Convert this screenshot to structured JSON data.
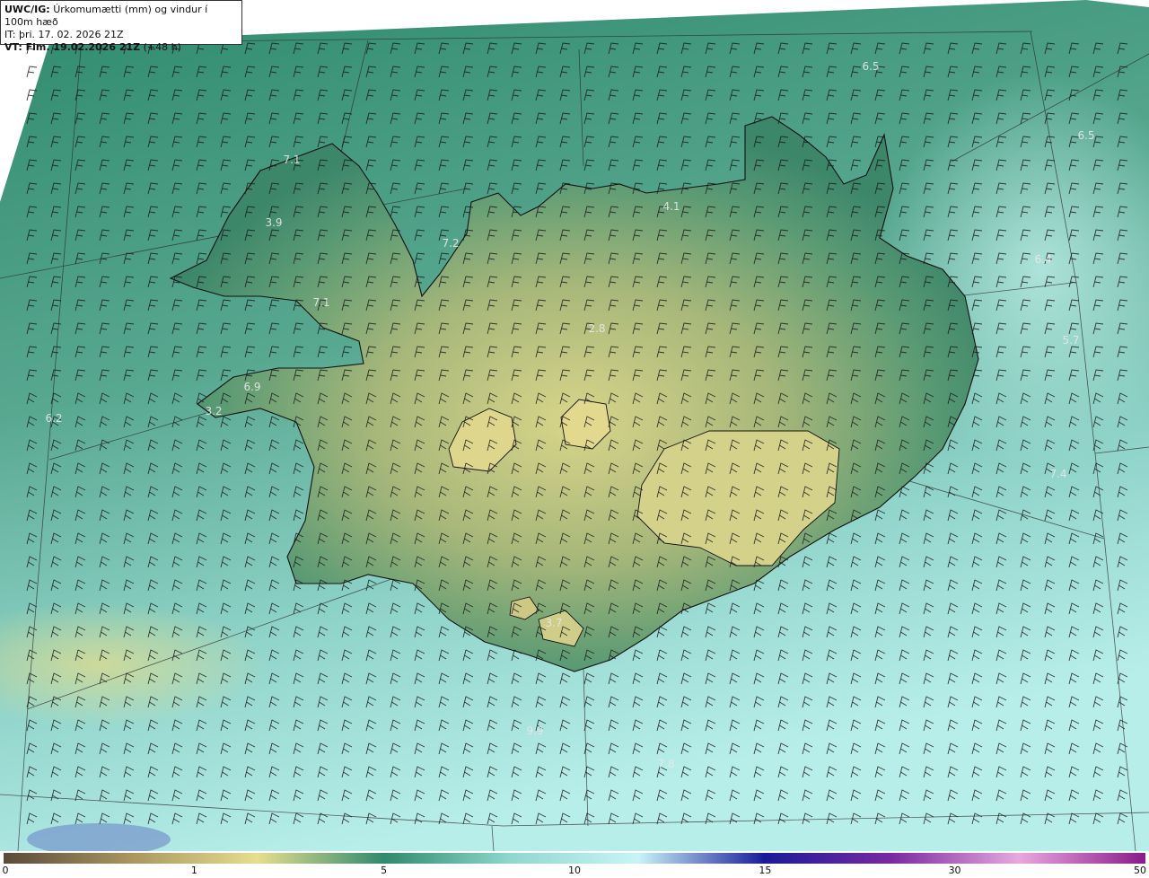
{
  "header": {
    "model_label": "UWC/IG:",
    "parameter": "Úrkomumætti (mm) og vindur í 100m hæð",
    "it_label": "IT:",
    "it_value": "þri. 17. 02. 2026 21Z",
    "vt_label": "VT: Fim. 19.02.2026 21Z",
    "vt_lead": "(+48 h)"
  },
  "colorbar": {
    "ticks": [
      {
        "label": "0",
        "value": 0
      },
      {
        "label": "1",
        "value": 1
      },
      {
        "label": "5",
        "value": 5
      },
      {
        "label": "10",
        "value": 10
      },
      {
        "label": "15",
        "value": 15
      },
      {
        "label": "30",
        "value": 30
      },
      {
        "label": "50",
        "value": 50
      }
    ],
    "colors": [
      "#5a4a3a",
      "#a99560",
      "#e6de8e",
      "#2f8a6e",
      "#8fd8cf",
      "#c8f4f6",
      "#1a1a9a",
      "#7a2aa0",
      "#e8a8e0",
      "#8a1a8a"
    ]
  },
  "map_values": [
    {
      "text": "6.5"
    },
    {
      "text": "6.5"
    },
    {
      "text": "7.1"
    },
    {
      "text": "3.9"
    },
    {
      "text": "7.2"
    },
    {
      "text": "4.1"
    },
    {
      "text": "6.4"
    },
    {
      "text": "7.1"
    },
    {
      "text": "2.8"
    },
    {
      "text": "5.7"
    },
    {
      "text": "6.9"
    },
    {
      "text": "6.2"
    },
    {
      "text": "3.2"
    },
    {
      "text": "7.4"
    },
    {
      "text": "3.7"
    },
    {
      "text": "9.9"
    },
    {
      "text": "7.8"
    }
  ],
  "colors": {
    "sea_north": "#3f8f78",
    "sea_south": "#9ee2dc",
    "land_low": "#3f8a6c",
    "land_high": "#d8d68a",
    "coast": "#111111",
    "barbs": "#1a1a1a"
  }
}
